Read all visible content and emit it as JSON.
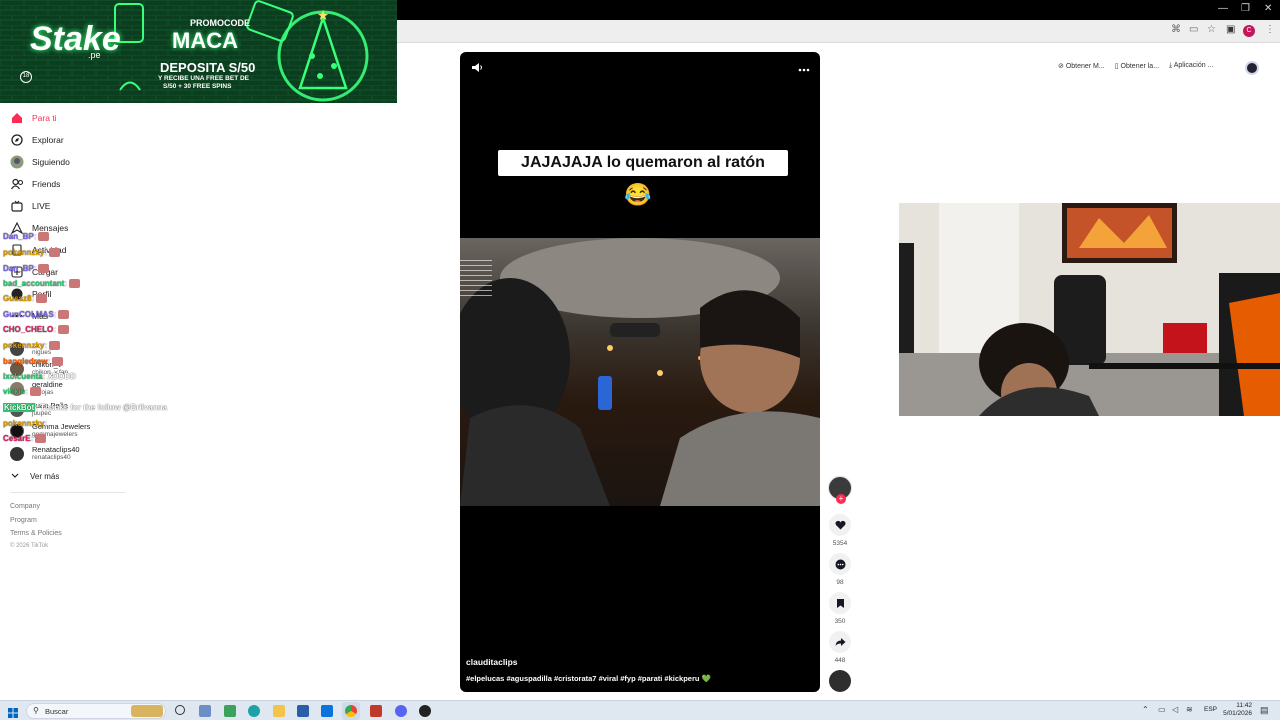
{
  "browser": {
    "profile_initial": "C",
    "toolbar_items": [
      {
        "label": "Obtener M...",
        "icon": "link-icon"
      },
      {
        "label": "Obtener la...",
        "icon": "phone-icon"
      },
      {
        "label": "Aplicación ...",
        "icon": "download-icon"
      }
    ]
  },
  "banner": {
    "brand": "Stake",
    "brand_sub": ".pe",
    "promo_label": "PROMOCODE",
    "promo_code": "MACA",
    "age_badge": "18",
    "headline": "DEPOSITA S/50",
    "subline1": "Y RECIBE UNA FREE BET DE",
    "subline2": "S/50 + 30 FREE SPINS"
  },
  "sidebar": {
    "nav": [
      {
        "label": "Para ti",
        "icon": "home-icon",
        "active": true
      },
      {
        "label": "Explorar",
        "icon": "compass-icon"
      },
      {
        "label": "Siguiendo",
        "icon": "following-icon"
      },
      {
        "label": "Friends",
        "icon": "friends-icon"
      },
      {
        "label": "LIVE",
        "icon": "live-icon"
      },
      {
        "label": "Mensajes",
        "icon": "message-icon"
      },
      {
        "label": "Actividad",
        "icon": "activity-icon"
      },
      {
        "label": "Cargar",
        "icon": "upload-icon"
      },
      {
        "label": "Perfil",
        "icon": "profile-icon"
      },
      {
        "label": "Más",
        "icon": "more-icon"
      }
    ],
    "following": [
      {
        "name": "...",
        "sub": "nigues"
      },
      {
        "name": "chikon_v",
        "sub": "chikon_v.fan"
      },
      {
        "name": "geraldine",
        "sub": "darojas"
      },
      {
        "name": "Juan Peña",
        "sub": "juupec"
      },
      {
        "name": "Gemma Jewelers",
        "sub": "gemmajewelers"
      },
      {
        "name": "Renataclips40",
        "sub": "renataclips40"
      }
    ],
    "see_more": "Ver más",
    "footer": [
      "Company",
      "Program",
      "Terms & Policies",
      "© 2026 TikTok"
    ]
  },
  "chat": {
    "lines": [
      {
        "user": "Dan_BP",
        "text": ":",
        "color": "#7b68ee"
      },
      {
        "user": "pokennzky",
        "text": ":",
        "color": "#e0a000"
      },
      {
        "user": "Dan_BP",
        "text": ":",
        "color": "#7b68ee"
      },
      {
        "user": "bad_accountant",
        "text": ":",
        "color": "#2ecc71"
      },
      {
        "user": "Gusaz8",
        "text": ":",
        "color": "#e0a000"
      },
      {
        "user": "GunCOLMAS",
        "text": ":",
        "color": "#7b68ee"
      },
      {
        "user": "CHO_CHELO",
        "text": ":",
        "color": "#e91e63"
      },
      {
        "user": "pokennzky",
        "text": ":",
        "color": "#e0a000"
      },
      {
        "user": "bangledrew",
        "text": ":",
        "color": "#ff5e00"
      },
      {
        "user": "lxolcuenta",
        "text": ": XDDDD",
        "color": "#2ecc71"
      },
      {
        "user": "vickie",
        "text": ":",
        "color": "#2ecc71"
      },
      {
        "user": "KickBot",
        "text": ": Thanks for the follow @Brilvanna",
        "color": "#ffffff"
      },
      {
        "user": "pokennzky",
        "text": ":",
        "color": "#e0a000"
      },
      {
        "user": "CesarE",
        "text": ":",
        "color": "#e91e63"
      }
    ]
  },
  "video": {
    "caption": "JAJAJAJA lo quemaron al ratón",
    "emoji": "😂",
    "author": "clauditaclips",
    "hashtags": "#elpelucas #aguspadilla #cristorata7 #viral #fyp #parati #kickperu 💚",
    "likes": "5354",
    "comments": "98",
    "saves": "350",
    "shares": "448"
  },
  "taskbar": {
    "search_placeholder": "Buscar",
    "language": "ESP",
    "time": "11:42",
    "date": "5/01/2026"
  },
  "colors": {
    "tiktok_red": "#fe2c55",
    "banner_green": "#0b3d1f",
    "neon_green": "#39ff7a"
  }
}
